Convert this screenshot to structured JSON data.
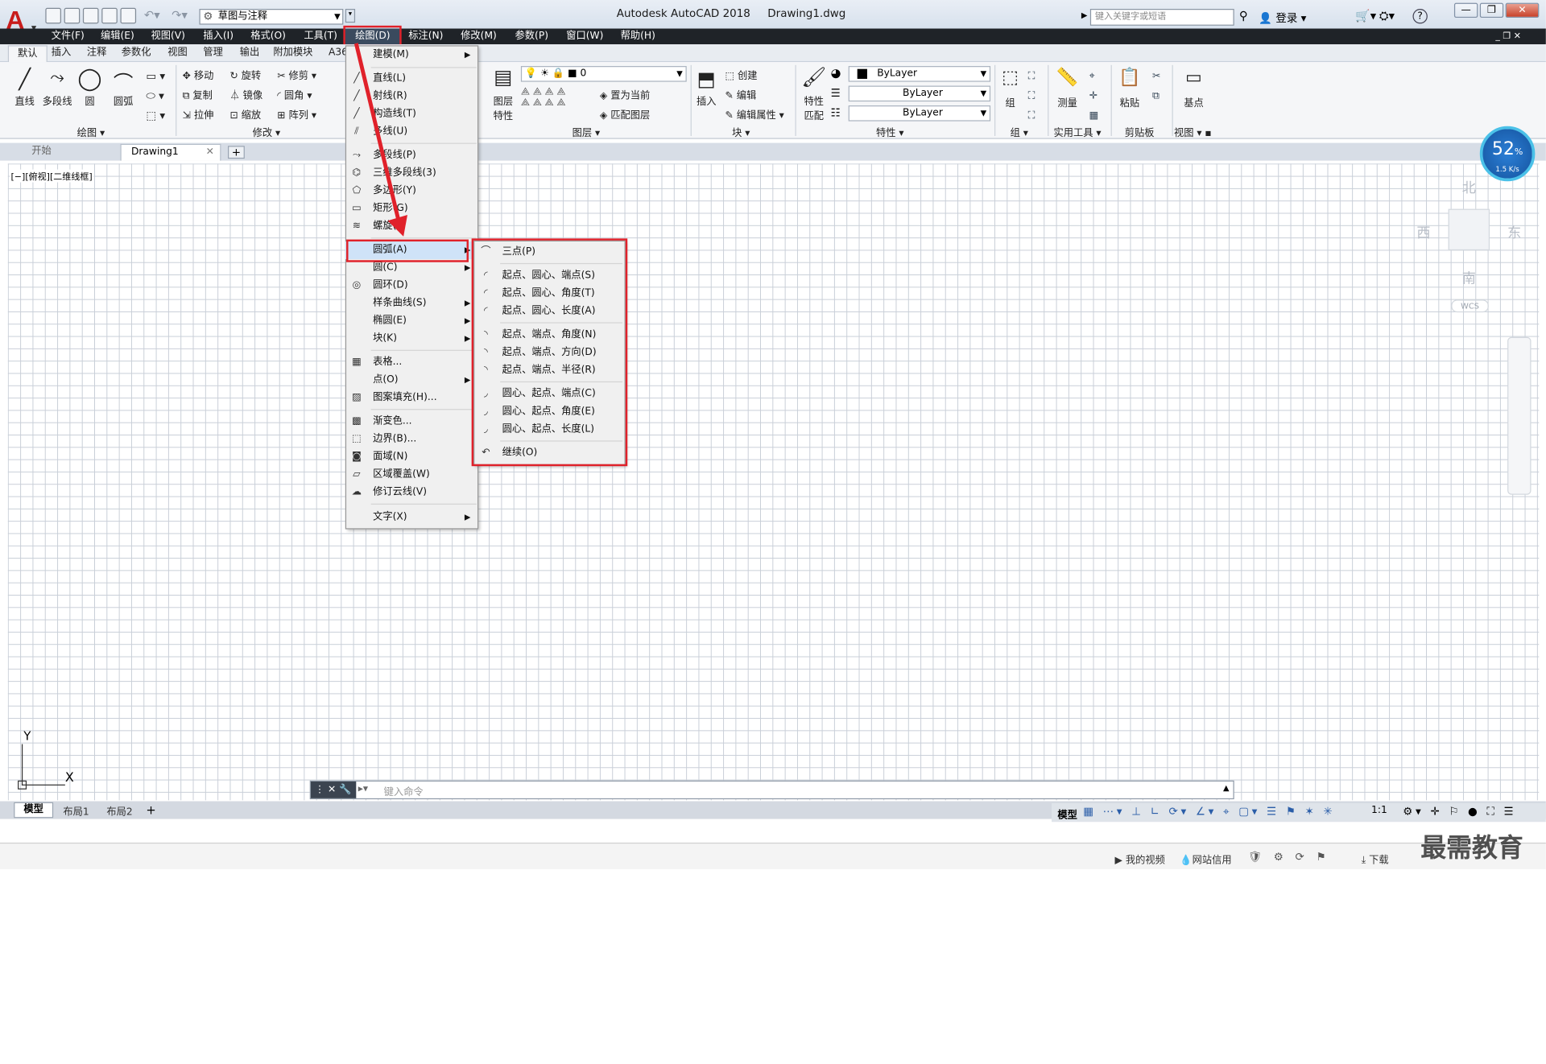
{
  "app": {
    "title": "Autodesk AutoCAD 2018",
    "file": "Drawing1.dwg",
    "logo": "A",
    "workspace": "草图与注释",
    "search_placeholder": "键入关键字或短语",
    "login": "登录"
  },
  "menubar": [
    "文件(F)",
    "编辑(E)",
    "视图(V)",
    "插入(I)",
    "格式(O)",
    "工具(T)",
    "绘图(D)",
    "标注(N)",
    "修改(M)",
    "参数(P)",
    "窗口(W)",
    "帮助(H)"
  ],
  "ribbon_tabs": [
    "默认",
    "插入",
    "注释",
    "参数化",
    "视图",
    "管理",
    "输出",
    "附加模块",
    "A36"
  ],
  "ribbon": {
    "draw": {
      "title": "绘图",
      "tools": [
        "直线",
        "多段线",
        "圆",
        "圆弧"
      ]
    },
    "modify": {
      "title": "修改",
      "tools": [
        "移动",
        "旋转",
        "修剪",
        "复制",
        "镜像",
        "圆角",
        "拉伸",
        "缩放",
        "阵列"
      ]
    },
    "layer": {
      "title": "图层",
      "big": "图层特性",
      "layer_value": "0",
      "tools": [
        "置为当前",
        "匹配图层"
      ]
    },
    "block": {
      "title": "块",
      "big": "插入",
      "tools": [
        "创建",
        "编辑",
        "编辑属性"
      ]
    },
    "properties": {
      "title": "特性",
      "big": "特性匹配",
      "color": "ByLayer",
      "linetype": "ByLayer",
      "lineweight": "ByLayer"
    },
    "group": {
      "title": "组",
      "big": "组"
    },
    "utilities": {
      "title": "实用工具",
      "big": "测量"
    },
    "clipboard": {
      "title": "剪贴板",
      "big": "粘贴"
    },
    "view": {
      "title": "视图",
      "big": "基点"
    }
  },
  "file_tabs": [
    "开始",
    "Drawing1"
  ],
  "viewport_label": "[−][俯视][二维线框]",
  "draw_menu": [
    {
      "label": "建模(M)",
      "sub": true
    },
    {
      "label": "直线(L)"
    },
    {
      "label": "射线(R)"
    },
    {
      "label": "构造线(T)"
    },
    {
      "label": "多线(U)"
    },
    {
      "label": "多段线(P)"
    },
    {
      "label": "三维多段线(3)"
    },
    {
      "label": "多边形(Y)"
    },
    {
      "label": "矩形(G)"
    },
    {
      "label": "螺旋(I)"
    },
    {
      "label": "圆弧(A)",
      "sub": true
    },
    {
      "label": "圆(C)",
      "sub": true
    },
    {
      "label": "圆环(D)"
    },
    {
      "label": "样条曲线(S)",
      "sub": true
    },
    {
      "label": "椭圆(E)",
      "sub": true
    },
    {
      "label": "块(K)",
      "sub": true
    },
    {
      "label": "表格..."
    },
    {
      "label": "点(O)",
      "sub": true
    },
    {
      "label": "图案填充(H)..."
    },
    {
      "label": "渐变色..."
    },
    {
      "label": "边界(B)..."
    },
    {
      "label": "面域(N)"
    },
    {
      "label": "区域覆盖(W)"
    },
    {
      "label": "修订云线(V)"
    },
    {
      "label": "文字(X)",
      "sub": true
    }
  ],
  "arc_submenu": [
    "三点(P)",
    "起点、圆心、端点(S)",
    "起点、圆心、角度(T)",
    "起点、圆心、长度(A)",
    "起点、端点、角度(N)",
    "起点、端点、方向(D)",
    "起点、端点、半径(R)",
    "圆心、起点、端点(C)",
    "圆心、起点、角度(E)",
    "圆心、起点、长度(L)",
    "继续(O)"
  ],
  "viewcube": {
    "north": "北",
    "south": "南",
    "east": "东",
    "west": "西",
    "wcs": "WCS"
  },
  "ucs": {
    "x": "X",
    "y": "Y"
  },
  "command_placeholder": "键入命令",
  "layout_tabs": [
    "模型",
    "布局1",
    "布局2"
  ],
  "status": {
    "model": "模型",
    "scale": "1:1"
  },
  "network_badge": {
    "percent": "52",
    "unit": "%",
    "speed": "1.5 K/s"
  },
  "taskbar": {
    "video": "我的视频",
    "credit": "网站信用",
    "download": "下载"
  },
  "watermark": "最需教育",
  "colors": {
    "highlight_box": "#e0212a",
    "menubar": "#1f2328",
    "grid": "#c9cfd8"
  }
}
